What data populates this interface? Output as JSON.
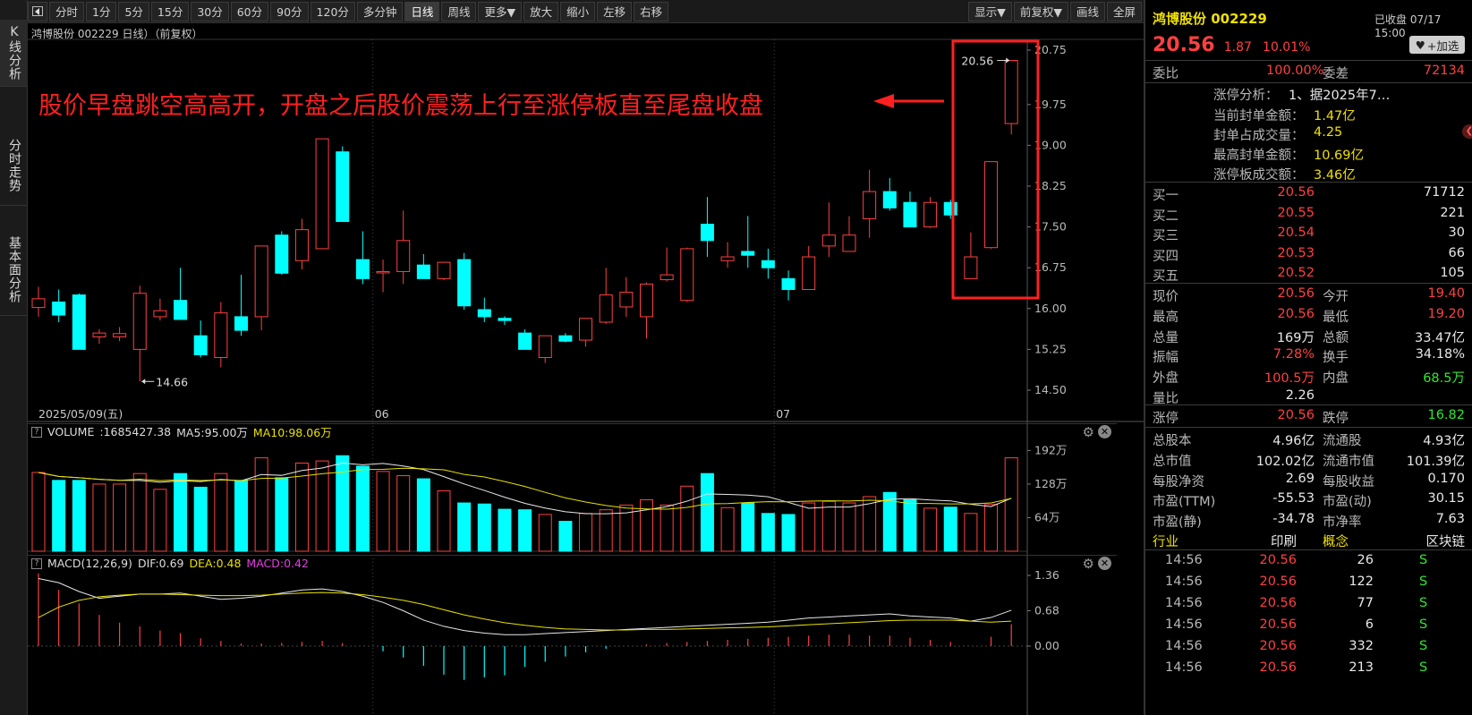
{
  "left_tabs": [
    {
      "label": "K线分析"
    },
    {
      "label": "分时走势"
    },
    {
      "label": "基本面分析"
    }
  ],
  "toolbar": {
    "left_items": [
      "分时",
      "1分",
      "5分",
      "15分",
      "30分",
      "60分",
      "90分",
      "120分",
      "多分钟",
      "日线",
      "周线",
      "更多▼",
      "放大",
      "缩小",
      "左移",
      "右移"
    ],
    "active": "日线",
    "right_items": [
      "显示▼",
      "前复权▼",
      "画线",
      "全屏"
    ]
  },
  "chart": {
    "header": "鸿博股份 002229 日线）（前复权）",
    "annotation": "股价早盘跳空高高开，开盘之后股价震荡上行至涨停板直至尾盘收盘",
    "price_axis": [
      "20.75",
      "19.75",
      "19.00",
      "18.25",
      "17.50",
      "16.75",
      "16.00",
      "15.25",
      "14.50"
    ],
    "high_label": "20.56",
    "low_label": "14.66",
    "date_labels": [
      "2025/05/09(五)",
      "06",
      "07"
    ],
    "volume_header": {
      "name": "VOLUME",
      "vol": ":1685427.38",
      "ma5": "MA5:95.00万",
      "ma10": "MA10:98.06万"
    },
    "volume_axis": [
      "192万",
      "128万",
      "64万"
    ],
    "macd_header": {
      "name": "MACD(12,26,9)",
      "dif": "DIF:0.69",
      "dea": "DEA:0.48",
      "macd": "MACD:0.42"
    },
    "macd_axis": [
      "1.36",
      "0.68",
      "0.00"
    ]
  },
  "chart_data": {
    "type": "candlestick",
    "candles": [
      {
        "o": 16.02,
        "h": 16.4,
        "l": 15.85,
        "c": 16.18
      },
      {
        "o": 16.12,
        "h": 16.35,
        "l": 15.75,
        "c": 15.88
      },
      {
        "o": 16.25,
        "h": 16.28,
        "l": 15.25,
        "c": 15.25
      },
      {
        "o": 15.48,
        "h": 15.62,
        "l": 15.35,
        "c": 15.55
      },
      {
        "o": 15.48,
        "h": 15.66,
        "l": 15.4,
        "c": 15.54
      },
      {
        "o": 15.25,
        "h": 16.42,
        "l": 14.66,
        "c": 16.28
      },
      {
        "o": 15.85,
        "h": 16.18,
        "l": 15.78,
        "c": 15.96
      },
      {
        "o": 16.15,
        "h": 16.75,
        "l": 15.8,
        "c": 15.8
      },
      {
        "o": 15.5,
        "h": 15.78,
        "l": 15.1,
        "c": 15.15
      },
      {
        "o": 15.1,
        "h": 16.12,
        "l": 14.92,
        "c": 15.92
      },
      {
        "o": 15.85,
        "h": 16.62,
        "l": 15.5,
        "c": 15.6
      },
      {
        "o": 15.85,
        "h": 16.75,
        "l": 15.6,
        "c": 17.15
      },
      {
        "o": 17.35,
        "h": 17.42,
        "l": 16.62,
        "c": 16.65
      },
      {
        "o": 16.88,
        "h": 17.65,
        "l": 16.72,
        "c": 17.45
      },
      {
        "o": 17.1,
        "h": 19.1,
        "l": 17.1,
        "c": 19.12
      },
      {
        "o": 18.88,
        "h": 18.98,
        "l": 17.6,
        "c": 17.6
      },
      {
        "o": 16.9,
        "h": 17.42,
        "l": 16.45,
        "c": 16.55
      },
      {
        "o": 16.68,
        "h": 16.9,
        "l": 16.3,
        "c": 16.68
      },
      {
        "o": 16.68,
        "h": 17.8,
        "l": 16.45,
        "c": 17.25
      },
      {
        "o": 16.8,
        "h": 17.0,
        "l": 16.55,
        "c": 16.55
      },
      {
        "o": 16.55,
        "h": 16.85,
        "l": 16.52,
        "c": 16.85
      },
      {
        "o": 16.9,
        "h": 17.02,
        "l": 15.98,
        "c": 16.05
      },
      {
        "o": 15.98,
        "h": 16.2,
        "l": 15.75,
        "c": 15.85
      },
      {
        "o": 15.82,
        "h": 15.86,
        "l": 15.7,
        "c": 15.78
      },
      {
        "o": 15.55,
        "h": 15.62,
        "l": 15.25,
        "c": 15.25
      },
      {
        "o": 15.1,
        "h": 15.5,
        "l": 15.0,
        "c": 15.5
      },
      {
        "o": 15.5,
        "h": 15.55,
        "l": 15.38,
        "c": 15.4
      },
      {
        "o": 15.42,
        "h": 15.82,
        "l": 15.3,
        "c": 15.82
      },
      {
        "o": 15.75,
        "h": 16.75,
        "l": 15.72,
        "c": 16.25
      },
      {
        "o": 16.03,
        "h": 16.58,
        "l": 15.85,
        "c": 16.3
      },
      {
        "o": 15.85,
        "h": 16.48,
        "l": 15.45,
        "c": 16.45
      },
      {
        "o": 16.53,
        "h": 17.12,
        "l": 16.5,
        "c": 16.62
      },
      {
        "o": 16.15,
        "h": 17.12,
        "l": 16.12,
        "c": 17.1
      },
      {
        "o": 17.55,
        "h": 18.05,
        "l": 16.95,
        "c": 17.25
      },
      {
        "o": 16.88,
        "h": 17.22,
        "l": 16.75,
        "c": 16.95
      },
      {
        "o": 17.05,
        "h": 17.7,
        "l": 16.75,
        "c": 16.98
      },
      {
        "o": 16.88,
        "h": 17.1,
        "l": 16.55,
        "c": 16.75
      },
      {
        "o": 16.55,
        "h": 16.7,
        "l": 16.15,
        "c": 16.35
      },
      {
        "o": 16.35,
        "h": 17.15,
        "l": 16.35,
        "c": 16.95
      },
      {
        "o": 17.15,
        "h": 17.95,
        "l": 16.95,
        "c": 17.35
      },
      {
        "o": 17.05,
        "h": 17.7,
        "l": 17.05,
        "c": 17.35
      },
      {
        "o": 17.65,
        "h": 18.55,
        "l": 17.3,
        "c": 18.15
      },
      {
        "o": 18.15,
        "h": 18.4,
        "l": 17.8,
        "c": 17.85
      },
      {
        "o": 17.95,
        "h": 18.15,
        "l": 17.5,
        "c": 17.5
      },
      {
        "o": 17.5,
        "h": 18.05,
        "l": 17.48,
        "c": 17.95
      },
      {
        "o": 17.95,
        "h": 18.0,
        "l": 17.65,
        "c": 17.72
      },
      {
        "o": 16.55,
        "h": 17.4,
        "l": 16.55,
        "c": 16.95
      },
      {
        "o": 17.12,
        "h": 18.7,
        "l": 17.1,
        "c": 18.7
      },
      {
        "o": 19.4,
        "h": 20.56,
        "l": 19.2,
        "c": 20.56
      }
    ],
    "volume_wan": [
      150,
      135,
      135,
      128,
      128,
      148,
      118,
      148,
      122,
      148,
      135,
      178,
      140,
      168,
      172,
      182,
      162,
      152,
      144,
      138,
      115,
      92,
      90,
      80,
      79,
      70,
      57,
      72,
      79,
      88,
      98,
      88,
      124,
      148,
      83,
      92,
      72,
      70,
      92,
      95,
      92,
      104,
      112,
      98,
      82,
      84,
      72,
      89,
      178
    ],
    "macd": {
      "dif": [
        1.3,
        1.22,
        1.05,
        0.92,
        0.96,
        1.0,
        1.0,
        1.02,
        0.96,
        0.9,
        0.92,
        0.96,
        1.02,
        1.08,
        1.1,
        1.05,
        0.96,
        0.84,
        0.68,
        0.5,
        0.38,
        0.3,
        0.25,
        0.22,
        0.22,
        0.24,
        0.26,
        0.28,
        0.3,
        0.32,
        0.34,
        0.36,
        0.38,
        0.4,
        0.42,
        0.44,
        0.46,
        0.5,
        0.54,
        0.56,
        0.58,
        0.6,
        0.62,
        0.58,
        0.56,
        0.54,
        0.48,
        0.55,
        0.69
      ],
      "dea": [
        0.55,
        0.75,
        0.88,
        0.95,
        0.98,
        1.0,
        1.0,
        0.99,
        0.98,
        0.97,
        0.97,
        0.98,
        1.0,
        1.02,
        1.03,
        1.02,
        0.99,
        0.94,
        0.88,
        0.8,
        0.7,
        0.6,
        0.52,
        0.45,
        0.4,
        0.36,
        0.33,
        0.32,
        0.31,
        0.31,
        0.32,
        0.32,
        0.33,
        0.34,
        0.35,
        0.36,
        0.37,
        0.39,
        0.41,
        0.43,
        0.45,
        0.47,
        0.49,
        0.5,
        0.5,
        0.5,
        0.48,
        0.46,
        0.48
      ],
      "hist": [
        1.4,
        1.08,
        0.82,
        0.6,
        0.45,
        0.38,
        0.3,
        0.25,
        0.15,
        0.1,
        0.05,
        0.05,
        0.06,
        0.08,
        0.1,
        0.06,
        0.0,
        -0.1,
        -0.22,
        -0.38,
        -0.55,
        -0.65,
        -0.6,
        -0.56,
        -0.4,
        -0.3,
        -0.2,
        -0.12,
        -0.05,
        0.0,
        0.03,
        0.06,
        0.08,
        0.1,
        0.12,
        0.14,
        0.16,
        0.18,
        0.2,
        0.22,
        0.22,
        0.2,
        0.2,
        0.16,
        0.12,
        0.08,
        0.0,
        0.18,
        0.42
      ]
    },
    "ylim_price": [
      14.5,
      20.75
    ],
    "ylim_volume": [
      0,
      2080000
    ],
    "ylim_macd": [
      -0.62,
      1.36
    ]
  },
  "quote": {
    "name": "鸿博股份",
    "code": "002229",
    "status": "已收盘",
    "time": "07/17 15:00",
    "price": "20.56",
    "change": "1.87",
    "pct": "10.01%",
    "add_button": "+加选",
    "weibi_label": "委比",
    "weibi": "100.00%",
    "weicha_label": "委差",
    "weicha": "72134",
    "zt_analysis_label": "涨停分析：",
    "zt_analysis": "1、据2025年7…",
    "info_rows": [
      {
        "label": "当前封单金额：",
        "value": "1.47亿"
      },
      {
        "label": "封单占成交量：",
        "value": "4.25"
      },
      {
        "label": "最高封单金额：",
        "value": "10.69亿"
      },
      {
        "label": "涨停板成交额：",
        "value": "3.46亿"
      }
    ],
    "bids": [
      {
        "label": "买一",
        "price": "20.56",
        "vol": "71712"
      },
      {
        "label": "买二",
        "price": "20.55",
        "vol": "221"
      },
      {
        "label": "买三",
        "price": "20.54",
        "vol": "30"
      },
      {
        "label": "买四",
        "price": "20.53",
        "vol": "66"
      },
      {
        "label": "买五",
        "price": "20.52",
        "vol": "105"
      }
    ],
    "stats": [
      {
        "l1": "现价",
        "v1": "20.56",
        "c1": "red",
        "l2": "今开",
        "v2": "19.40",
        "c2": "red"
      },
      {
        "l1": "最高",
        "v1": "20.56",
        "c1": "red",
        "l2": "最低",
        "v2": "19.20",
        "c2": "red"
      },
      {
        "l1": "总量",
        "v1": "169万",
        "c1": "wht",
        "l2": "总额",
        "v2": "33.47亿",
        "c2": "wht"
      },
      {
        "l1": "振幅",
        "v1": "7.28%",
        "c1": "red",
        "l2": "换手",
        "v2": "34.18%",
        "c2": "wht"
      },
      {
        "l1": "外盘",
        "v1": "100.5万",
        "c1": "red",
        "l2": "内盘",
        "v2": "68.5万",
        "c2": "green"
      },
      {
        "l1": "量比",
        "v1": "2.26",
        "c1": "wht",
        "l2": "",
        "v2": "",
        "c2": "wht"
      }
    ],
    "limits": {
      "l1": "涨停",
      "v1": "20.56",
      "l2": "跌停",
      "v2": "16.82"
    },
    "fundamentals": [
      {
        "l1": "总股本",
        "v1": "4.96亿",
        "l2": "流通股",
        "v2": "4.93亿"
      },
      {
        "l1": "总市值",
        "v1": "102.02亿",
        "l2": "流通市值",
        "v2": "101.39亿"
      },
      {
        "l1": "每股净资",
        "v1": "2.69",
        "l2": "每股收益",
        "v2": "0.170"
      },
      {
        "l1": "市盈(TTM)",
        "v1": "-55.53",
        "l2": "市盈(动)",
        "v2": "30.15"
      },
      {
        "l1": "市盈(静)",
        "v1": "-34.78",
        "l2": "市净率",
        "v2": "7.63"
      }
    ],
    "industry": {
      "l1": "行业",
      "v1": "印刷",
      "l2": "概念",
      "v2": "区块链"
    },
    "ticks": [
      {
        "time": "14:56",
        "price": "20.56",
        "vol": "26",
        "flag": "S"
      },
      {
        "time": "14:56",
        "price": "20.56",
        "vol": "122",
        "flag": "S"
      },
      {
        "time": "14:56",
        "price": "20.56",
        "vol": "77",
        "flag": "S"
      },
      {
        "time": "14:56",
        "price": "20.56",
        "vol": "6",
        "flag": "S"
      },
      {
        "time": "14:56",
        "price": "20.56",
        "vol": "332",
        "flag": "S"
      },
      {
        "time": "14:56",
        "price": "20.56",
        "vol": "213",
        "flag": "S"
      }
    ],
    "colors": {
      "up": "#ff4040",
      "down": "#00ffff",
      "ma5": "#e8e8e8",
      "ma10": "#e8e000",
      "annotation": "#ff2020"
    }
  }
}
